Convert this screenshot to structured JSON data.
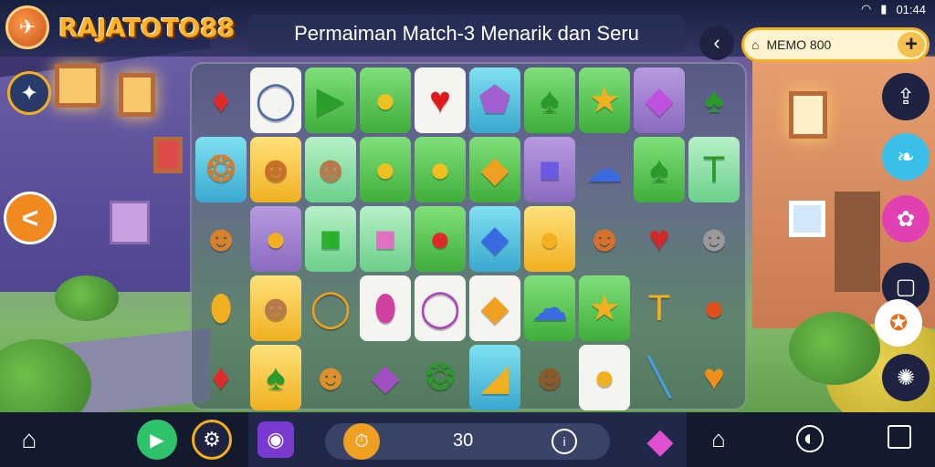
{
  "header": {
    "brand": "RAJATOTO88",
    "title": "Permaiman Match-3  Menarik dan Seru",
    "search_text": "MEMO 800",
    "status_time": "01:44"
  },
  "left_sidebar": [
    {
      "name": "compass-icon",
      "glyph": "✦"
    },
    {
      "name": "back-arrow-icon",
      "glyph": "<"
    }
  ],
  "right_sidebar": [
    {
      "name": "share-icon",
      "glyph": "⇪"
    },
    {
      "name": "leaf-icon",
      "glyph": "❧"
    },
    {
      "name": "puzzle-icon",
      "glyph": "✿"
    },
    {
      "name": "square-icon",
      "glyph": "▢"
    },
    {
      "name": "squirrel-icon",
      "glyph": "✪"
    },
    {
      "name": "loading-icon",
      "glyph": "✺"
    }
  ],
  "board": {
    "rows": [
      [
        {
          "g": "♦",
          "c": "#e02a2a",
          "bg": ""
        },
        {
          "g": "◯",
          "c": "#4a6aa8",
          "bg": "hl-white"
        },
        {
          "g": "▶",
          "c": "#2aa02a",
          "bg": "hl-green"
        },
        {
          "g": "●",
          "c": "#f0c020",
          "bg": "hl-green"
        },
        {
          "g": "♥",
          "c": "#e01a1a",
          "bg": "hl-white"
        },
        {
          "g": "⬟",
          "c": "#a060d0",
          "bg": "hl-cyan"
        },
        {
          "g": "♠",
          "c": "#2a9a2a",
          "bg": "hl-green"
        },
        {
          "g": "★",
          "c": "#f0b020",
          "bg": "hl-green"
        },
        {
          "g": "◆",
          "c": "#c050e0",
          "bg": "hl-purple"
        },
        {
          "g": "♠",
          "c": "#2a9a2a",
          "bg": ""
        }
      ],
      [
        {
          "g": "❂",
          "c": "#e07a20",
          "bg": "hl-cyan"
        },
        {
          "g": "☻",
          "c": "#c8702a",
          "bg": "hl-yellow"
        },
        {
          "g": "☻",
          "c": "#b87a4a",
          "bg": "hl-mint"
        },
        {
          "g": "●",
          "c": "#f0c020",
          "bg": "hl-green"
        },
        {
          "g": "●",
          "c": "#f0c020",
          "bg": "hl-green"
        },
        {
          "g": "◆",
          "c": "#f0a020",
          "bg": "hl-green"
        },
        {
          "g": "■",
          "c": "#6a5ae0",
          "bg": "hl-purple"
        },
        {
          "g": "☁",
          "c": "#3a6ae0",
          "bg": ""
        },
        {
          "g": "♠",
          "c": "#2a9a2a",
          "bg": "hl-green"
        },
        {
          "g": "T",
          "c": "#2a9a2a",
          "bg": "hl-mint"
        }
      ],
      [
        {
          "g": "☻",
          "c": "#d8802a",
          "bg": ""
        },
        {
          "g": "●",
          "c": "#f0b020",
          "bg": "hl-purple"
        },
        {
          "g": "■",
          "c": "#2ab02a",
          "bg": "hl-mint"
        },
        {
          "g": "■",
          "c": "#e070c0",
          "bg": "hl-mint"
        },
        {
          "g": "●",
          "c": "#e02a2a",
          "bg": "hl-green"
        },
        {
          "g": "◆",
          "c": "#3a6ae0",
          "bg": "hl-cyan"
        },
        {
          "g": "●",
          "c": "#f0b020",
          "bg": "hl-yellow"
        },
        {
          "g": "☻",
          "c": "#d8702a",
          "bg": ""
        },
        {
          "g": "♥",
          "c": "#d02a2a",
          "bg": ""
        },
        {
          "g": "☻",
          "c": "#9a9a9a",
          "bg": ""
        }
      ],
      [
        {
          "g": "⬮",
          "c": "#f0b020",
          "bg": ""
        },
        {
          "g": "☻",
          "c": "#b87a4a",
          "bg": "hl-yellow"
        },
        {
          "g": "◯",
          "c": "#f0a020",
          "bg": ""
        },
        {
          "g": "⬮",
          "c": "#d040a0",
          "bg": "hl-white"
        },
        {
          "g": "◯",
          "c": "#b040c0",
          "bg": "hl-white"
        },
        {
          "g": "◆",
          "c": "#f0a020",
          "bg": "hl-white"
        },
        {
          "g": "☁",
          "c": "#3a6ae0",
          "bg": "hl-green"
        },
        {
          "g": "★",
          "c": "#f0b020",
          "bg": "hl-green"
        },
        {
          "g": "T",
          "c": "#f0b020",
          "bg": ""
        },
        {
          "g": "●",
          "c": "#e0501a",
          "bg": ""
        }
      ],
      [
        {
          "g": "♦",
          "c": "#e02a2a",
          "bg": ""
        },
        {
          "g": "♠",
          "c": "#2a9a2a",
          "bg": "hl-yellow"
        },
        {
          "g": "☻",
          "c": "#e0902a",
          "bg": ""
        },
        {
          "g": "◆",
          "c": "#a050c0",
          "bg": ""
        },
        {
          "g": "❂",
          "c": "#2a9a2a",
          "bg": ""
        },
        {
          "g": "◢",
          "c": "#f0b020",
          "bg": "hl-cyan"
        },
        {
          "g": "☻",
          "c": "#8a5a2a",
          "bg": ""
        },
        {
          "g": "●",
          "c": "#f0b020",
          "bg": "hl-white"
        },
        {
          "g": "╲",
          "c": "#4aa0e0",
          "bg": ""
        },
        {
          "g": "♥",
          "c": "#f0901a",
          "bg": ""
        }
      ]
    ]
  },
  "bottom": {
    "moves": "30",
    "colors": {
      "play": "#2ec26a",
      "settings_ring": "#f0b020",
      "gem": "#e050d0"
    }
  }
}
